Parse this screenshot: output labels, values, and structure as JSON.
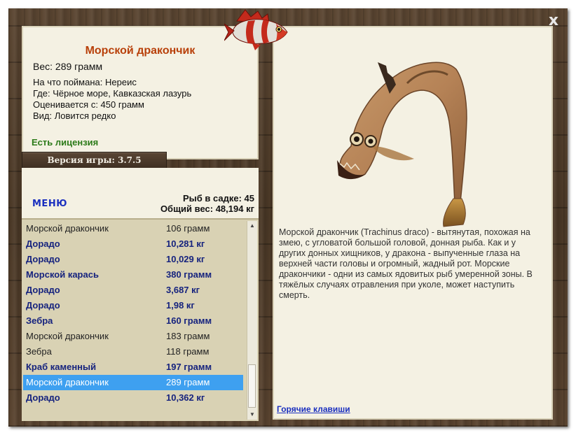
{
  "window": {
    "close_label": "x"
  },
  "fish": {
    "title": "Морской дракончик",
    "weight": "Вес: 289 грамм",
    "details": [
      "На что поймана: Нереис",
      "Где: Чёрное море, Кавказская лазурь",
      "Оценивается с: 450 грамм",
      "Вид: Ловится редко"
    ],
    "license": "Есть лицензия"
  },
  "version": "Версия игры: 3.7.5",
  "menu_label": "МЕНЮ",
  "stats": {
    "fish_count": "Рыб в садке: 45",
    "total_weight": "Общий вес: 48,194 кг"
  },
  "catch_list": [
    {
      "name": "Морской дракончик",
      "weight": "106 грамм",
      "style": "plain"
    },
    {
      "name": "Дорадо",
      "weight": "10,281 кг",
      "style": "bold"
    },
    {
      "name": "Дорадо",
      "weight": "10,029 кг",
      "style": "bold"
    },
    {
      "name": "Морской карась",
      "weight": "380 грамм",
      "style": "bold"
    },
    {
      "name": "Дорадо",
      "weight": "3,687 кг",
      "style": "bold"
    },
    {
      "name": "Дорадо",
      "weight": "1,98 кг",
      "style": "bold"
    },
    {
      "name": "Зебра",
      "weight": "160 грамм",
      "style": "bold"
    },
    {
      "name": "Морской дракончик",
      "weight": "183 грамм",
      "style": "plain"
    },
    {
      "name": "Зебра",
      "weight": "118 грамм",
      "style": "plain"
    },
    {
      "name": "Краб каменный",
      "weight": "197 грамм",
      "style": "bold"
    },
    {
      "name": "Морской дракончик",
      "weight": "289 грамм",
      "style": "selected"
    },
    {
      "name": "Дорадо",
      "weight": "10,362 кг",
      "style": "bold"
    }
  ],
  "description": "Морской дракончик (Trachinus draco) - вытянутая, похожая на змею, с угловатой большой головой, донная рыба. Как и у других донных хищников, у дракона - выпученные глаза на верхней части головы и огромный, жадный рот. Морские дракончики - одни из самых ядовитых рыб умеренной зоны. В тяжёлых случаях отравления при уколе, может наступить смерть.",
  "hotkeys_label": "Горячие клавиши",
  "colors": {
    "title": "#b8400a",
    "license": "#2b7a18",
    "link": "#1a2fbf",
    "bold_row": "#16237e",
    "selected_row": "#3ea0f0",
    "panel_bg": "#f4f1e3",
    "list_bg": "#d9d2b4"
  }
}
